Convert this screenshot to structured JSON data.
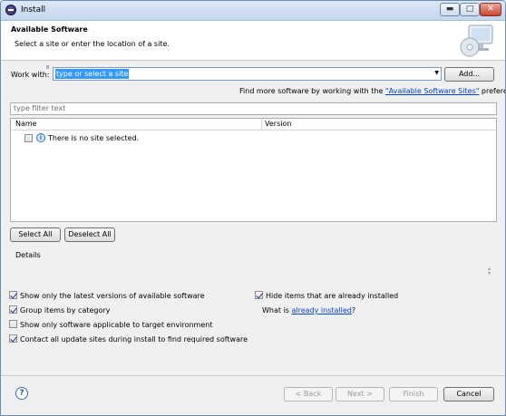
{
  "window": {
    "title": "Install",
    "minimize_glyph": "▬",
    "maximize_glyph": "□",
    "close_glyph": "✕"
  },
  "header": {
    "title": "Available Software",
    "description": "Select a site or enter the location of a site."
  },
  "work_with": {
    "label": "Work with:",
    "required_marker": "8",
    "value": "type or select a site",
    "add_button": "Add..."
  },
  "find_more": {
    "prefix": "Find more software by working with the ",
    "link": "\"Available Software Sites\"",
    "suffix": " preferences."
  },
  "filter": {
    "placeholder": "type filter text"
  },
  "table": {
    "columns": [
      "Name",
      "Version"
    ],
    "rows": [
      {
        "checked": false,
        "icon": "info-icon",
        "name": "There is no site selected."
      }
    ]
  },
  "selection_buttons": {
    "select_all": "Select All",
    "deselect_all": "Deselect All"
  },
  "details": {
    "label": "Details"
  },
  "options": [
    {
      "label": "Show only the latest versions of available software",
      "checked": true
    },
    {
      "label": "Group items by category",
      "checked": true
    },
    {
      "label": "Show only software applicable to target environment",
      "checked": false
    },
    {
      "label": "Contact all update sites during install to find required software",
      "checked": true
    },
    {
      "label": "Hide items that are already installed",
      "checked": true
    }
  ],
  "installed_query": {
    "prefix": "What is ",
    "link": "already installed",
    "suffix": "?"
  },
  "footer": {
    "help_glyph": "?",
    "back": "< Back",
    "next": "Next >",
    "finish": "Finish",
    "cancel": "Cancel"
  },
  "colors": {
    "selection": "#3399ff",
    "link": "#0044cc",
    "title_bar": "#c3d6ec",
    "close_button": "#c8452f"
  }
}
